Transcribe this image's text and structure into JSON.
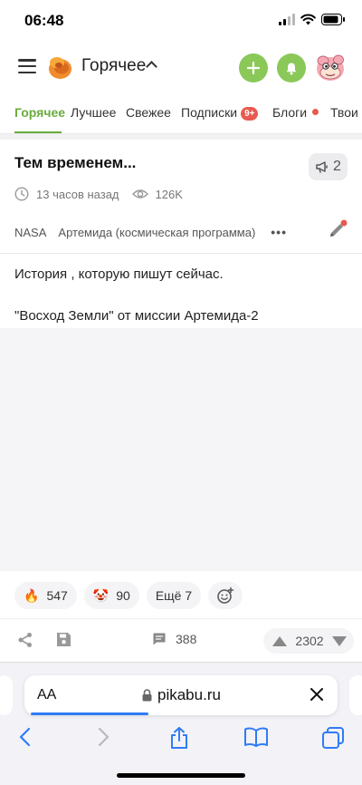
{
  "status_bar": {
    "time": "06:48"
  },
  "header": {
    "title": "Горячее"
  },
  "tabs": [
    {
      "label": "Горячее"
    },
    {
      "label": "Лучшее"
    },
    {
      "label": "Свежее"
    },
    {
      "label": "Подписки",
      "badge": "9+"
    },
    {
      "label": "Блоги"
    },
    {
      "label": "Твои"
    }
  ],
  "post": {
    "title": "Тем временем...",
    "comments_badge": "2",
    "time_ago": "13 часов назад",
    "views": "126K",
    "tags": [
      "NASA",
      "Артемида (космическая программа)"
    ],
    "body": [
      "История , которую пишут сейчас.",
      "\"Восход Земли\" от миссии Артемида-2"
    ],
    "reactions": [
      {
        "emoji": "🔥",
        "count": "547"
      },
      {
        "emoji": "🤡",
        "count": "90"
      }
    ],
    "more_reactions": "Ещё 7",
    "comments_count": "388",
    "rating": "2302"
  },
  "browser": {
    "aa_label": "AA",
    "url": "pikabu.ru"
  },
  "colors": {
    "accent": "#6aab3e",
    "button_green": "#8ac858",
    "badge_red": "#e85a4f",
    "safari_blue": "#2f7cf6"
  }
}
